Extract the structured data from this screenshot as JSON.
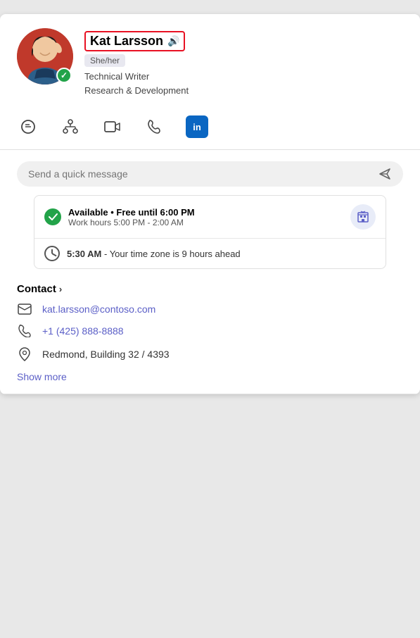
{
  "profile": {
    "name": "Kat Larsson",
    "pronouns": "She/her",
    "title": "Technical Writer",
    "department": "Research & Development",
    "status": "online"
  },
  "actions": {
    "chat_label": "Chat",
    "org_label": "Organization",
    "video_label": "Video call",
    "phone_label": "Phone call",
    "linkedin_label": "in"
  },
  "message": {
    "placeholder": "Send a quick message"
  },
  "availability": {
    "status": "Available • Free until 6:00 PM",
    "work_hours": "Work hours 5:00 PM - 2:00 AM",
    "time_text": "5:30 AM",
    "time_suffix": " - Your time zone is 9 hours ahead"
  },
  "contact": {
    "header": "Contact",
    "email": "kat.larsson@contoso.com",
    "phone": "+1 (425) 888-8888",
    "location": "Redmond, Building 32 / 4393",
    "show_more": "Show more"
  }
}
